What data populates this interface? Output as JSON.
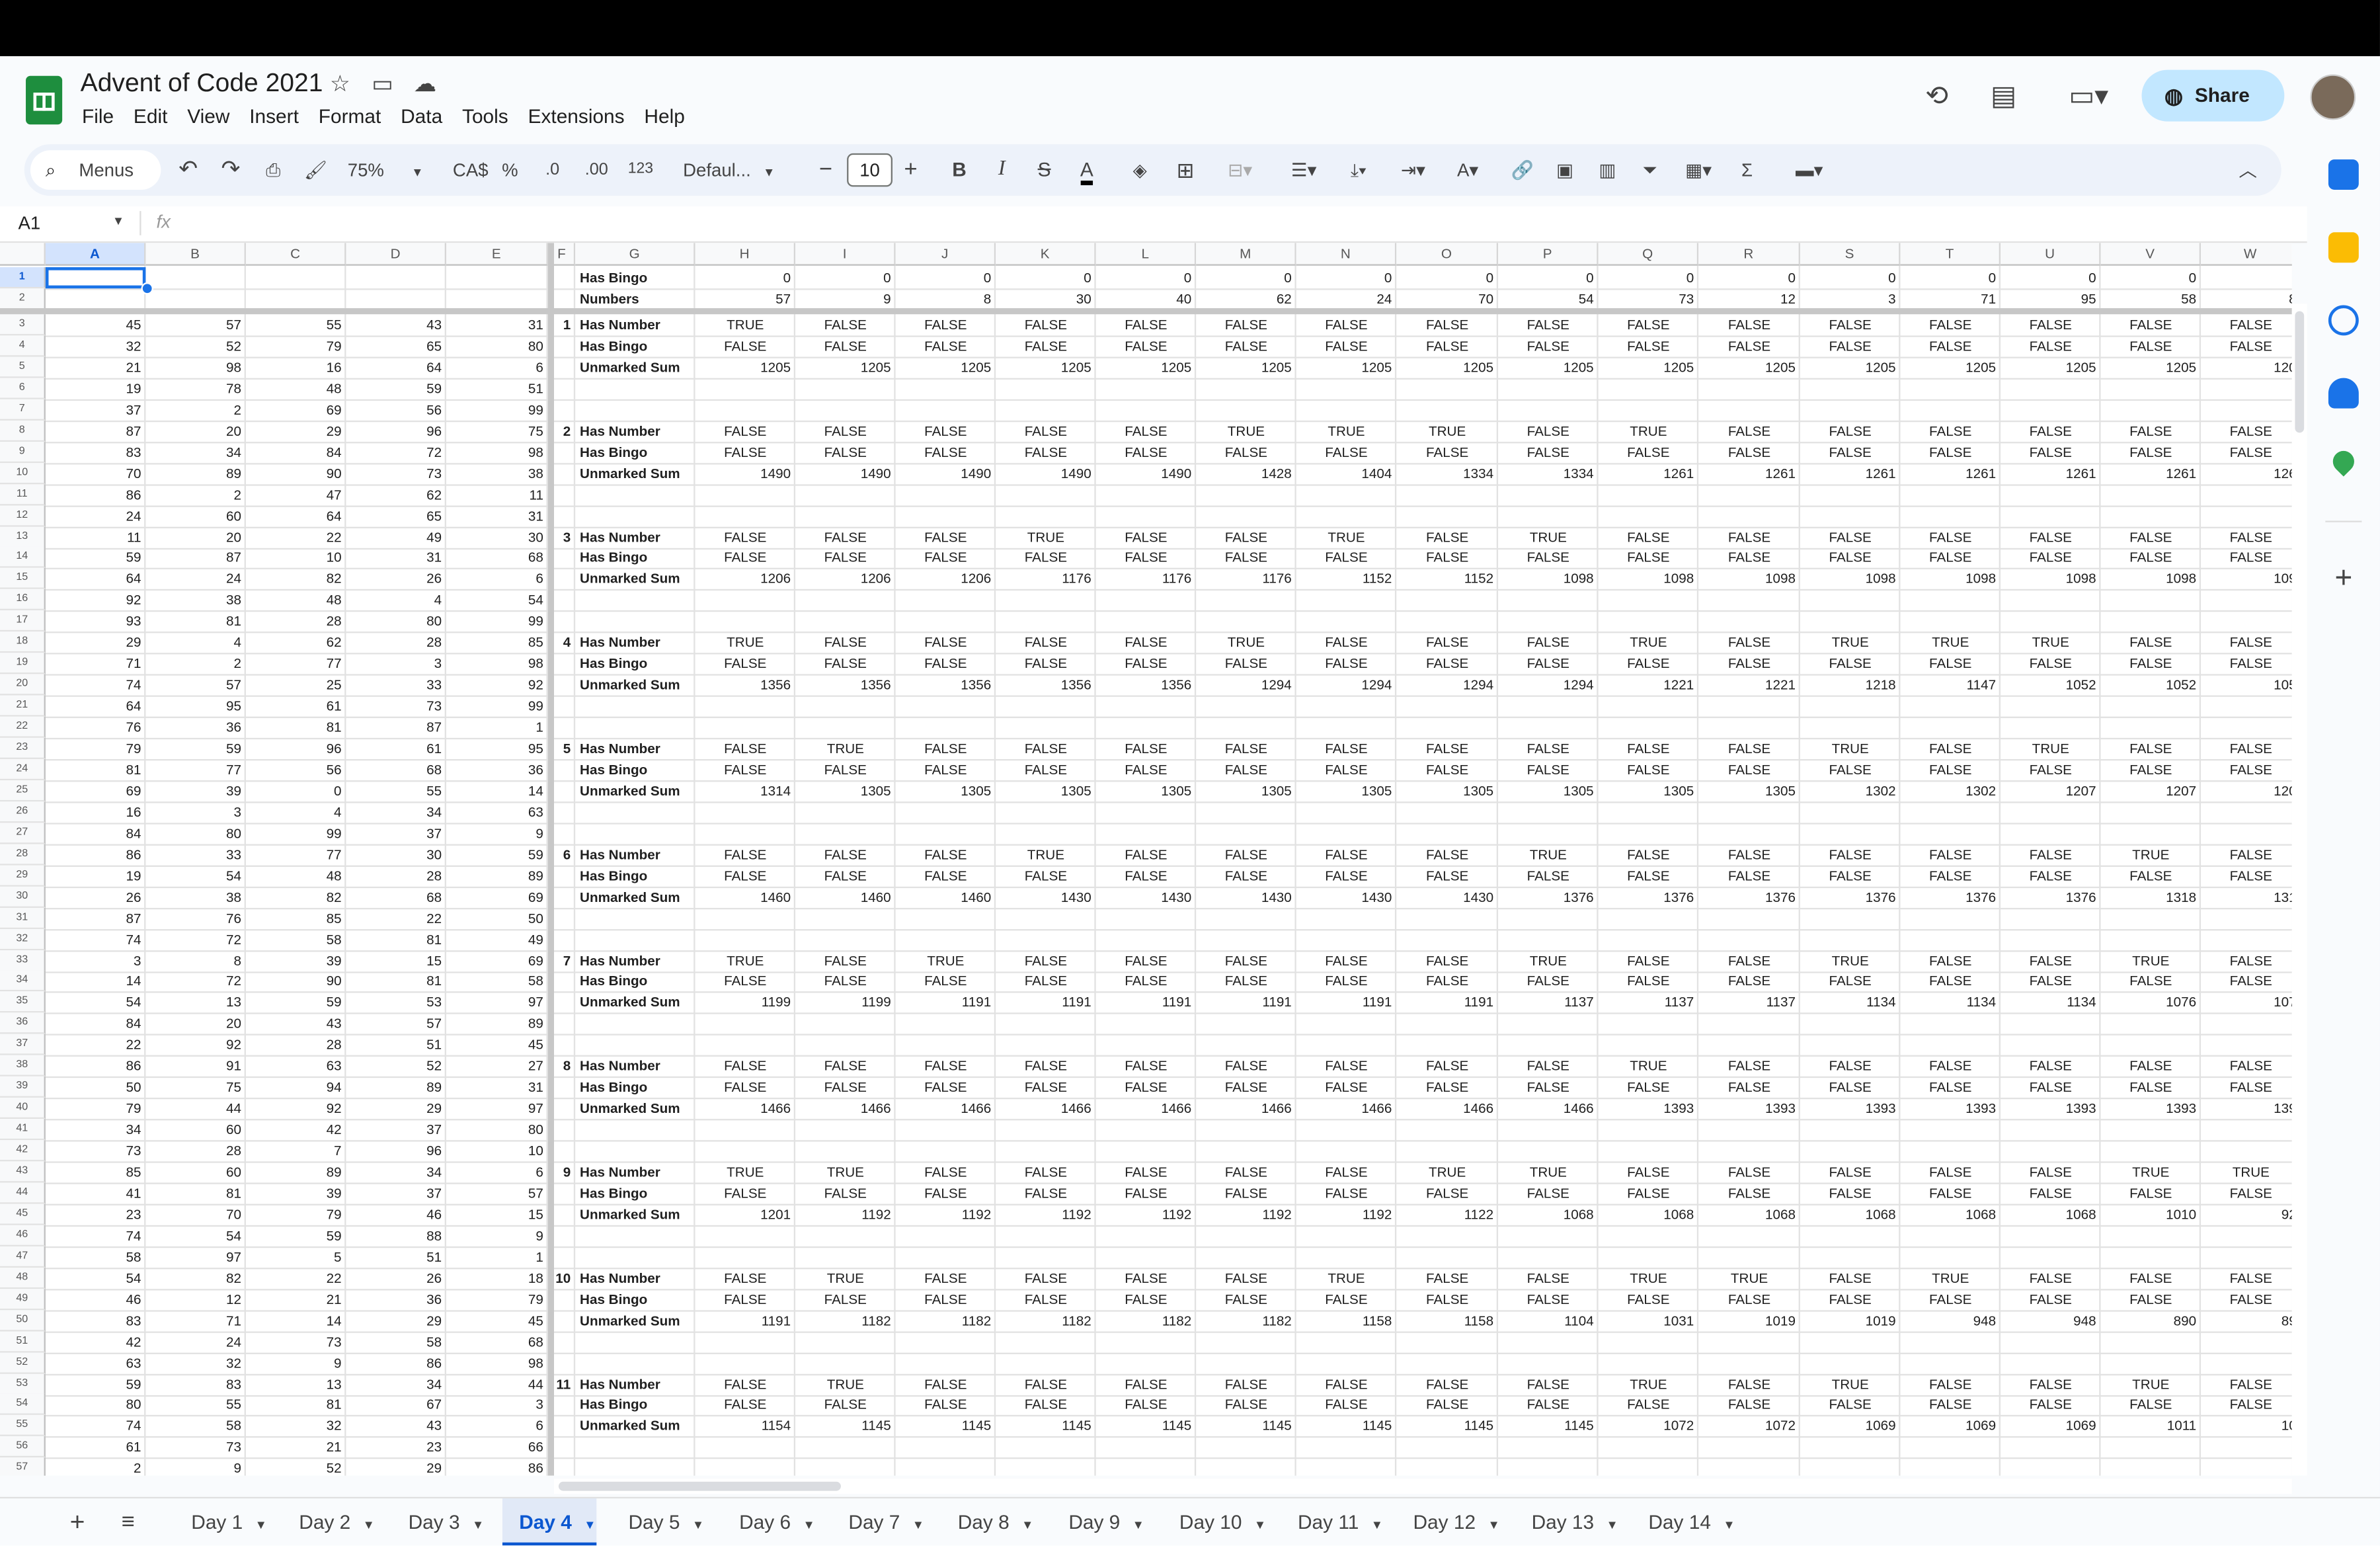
{
  "window": {
    "title": "Advent of Code 2021"
  },
  "menubar": [
    "File",
    "Edit",
    "View",
    "Insert",
    "Format",
    "Data",
    "Tools",
    "Extensions",
    "Help"
  ],
  "header": {
    "share_label": "Share"
  },
  "toolbar": {
    "search_label": "Menus",
    "zoom": "75%",
    "currency": "CA$",
    "percent": "%",
    "decimal_less": ".0",
    "decimal_more": ".00",
    "number_format": "123",
    "font": "Defaul...",
    "font_size": "10"
  },
  "formula_bar": {
    "cell_ref": "A1",
    "fx_label": "fx",
    "value": ""
  },
  "columns": [
    "A",
    "B",
    "C",
    "D",
    "E",
    "F",
    "G",
    "H",
    "I",
    "J",
    "K",
    "L",
    "M",
    "N",
    "O",
    "P",
    "Q",
    "R",
    "S",
    "T",
    "U",
    "V",
    "W"
  ],
  "header_rows": {
    "row1_label": "Has Bingo",
    "row1_values": [
      "0",
      "0",
      "0",
      "0",
      "0",
      "0",
      "0",
      "0",
      "0",
      "0",
      "0",
      "0",
      "0",
      "0",
      "0"
    ],
    "row2_label": "Numbers",
    "row2_values": [
      "57",
      "9",
      "8",
      "30",
      "40",
      "62",
      "24",
      "70",
      "54",
      "73",
      "12",
      "3",
      "71",
      "95",
      "58",
      "8"
    ]
  },
  "labels": {
    "has_number": "Has Number",
    "has_bingo": "Has Bingo",
    "unmarked_sum": "Unmarked Sum"
  },
  "input_rows": [
    [
      "45",
      "57",
      "55",
      "43",
      "31"
    ],
    [
      "32",
      "52",
      "79",
      "65",
      "80"
    ],
    [
      "21",
      "98",
      "16",
      "64",
      "6"
    ],
    [
      "19",
      "78",
      "48",
      "59",
      "51"
    ],
    [
      "37",
      "2",
      "69",
      "56",
      "99"
    ],
    [
      "87",
      "20",
      "29",
      "96",
      "75"
    ],
    [
      "83",
      "34",
      "84",
      "72",
      "98"
    ],
    [
      "70",
      "89",
      "90",
      "73",
      "38"
    ],
    [
      "86",
      "2",
      "47",
      "62",
      "11"
    ],
    [
      "24",
      "60",
      "64",
      "65",
      "31"
    ],
    [
      "11",
      "20",
      "22",
      "49",
      "30"
    ],
    [
      "59",
      "87",
      "10",
      "31",
      "68"
    ],
    [
      "64",
      "24",
      "82",
      "26",
      "6"
    ],
    [
      "92",
      "38",
      "48",
      "4",
      "54"
    ],
    [
      "93",
      "81",
      "28",
      "80",
      "99"
    ],
    [
      "29",
      "4",
      "62",
      "28",
      "85"
    ],
    [
      "71",
      "2",
      "77",
      "3",
      "98"
    ],
    [
      "74",
      "57",
      "25",
      "33",
      "92"
    ],
    [
      "64",
      "95",
      "61",
      "73",
      "99"
    ],
    [
      "76",
      "36",
      "81",
      "87",
      "1"
    ],
    [
      "79",
      "59",
      "96",
      "61",
      "95"
    ],
    [
      "81",
      "77",
      "56",
      "68",
      "36"
    ],
    [
      "69",
      "39",
      "0",
      "55",
      "14"
    ],
    [
      "16",
      "3",
      "4",
      "34",
      "63"
    ],
    [
      "84",
      "80",
      "99",
      "37",
      "9"
    ],
    [
      "86",
      "33",
      "77",
      "30",
      "59"
    ],
    [
      "19",
      "54",
      "48",
      "28",
      "89"
    ],
    [
      "26",
      "38",
      "82",
      "68",
      "69"
    ],
    [
      "87",
      "76",
      "85",
      "22",
      "50"
    ],
    [
      "74",
      "72",
      "58",
      "81",
      "49"
    ],
    [
      "3",
      "8",
      "39",
      "15",
      "69"
    ],
    [
      "14",
      "72",
      "90",
      "81",
      "58"
    ],
    [
      "54",
      "13",
      "59",
      "53",
      "97"
    ],
    [
      "84",
      "20",
      "43",
      "57",
      "89"
    ],
    [
      "22",
      "92",
      "28",
      "51",
      "45"
    ],
    [
      "86",
      "91",
      "63",
      "52",
      "27"
    ],
    [
      "50",
      "75",
      "94",
      "89",
      "31"
    ],
    [
      "79",
      "44",
      "92",
      "29",
      "97"
    ],
    [
      "34",
      "60",
      "42",
      "37",
      "80"
    ],
    [
      "73",
      "28",
      "7",
      "96",
      "10"
    ],
    [
      "85",
      "60",
      "89",
      "34",
      "6"
    ],
    [
      "41",
      "81",
      "39",
      "37",
      "57"
    ],
    [
      "23",
      "70",
      "79",
      "46",
      "15"
    ],
    [
      "74",
      "54",
      "59",
      "88",
      "9"
    ],
    [
      "58",
      "97",
      "5",
      "51",
      "1"
    ],
    [
      "54",
      "82",
      "22",
      "26",
      "18"
    ],
    [
      "46",
      "12",
      "21",
      "36",
      "79"
    ],
    [
      "83",
      "71",
      "14",
      "29",
      "45"
    ],
    [
      "42",
      "24",
      "73",
      "58",
      "68"
    ],
    [
      "63",
      "32",
      "9",
      "86",
      "98"
    ],
    [
      "59",
      "83",
      "13",
      "34",
      "44"
    ],
    [
      "80",
      "55",
      "81",
      "67",
      "3"
    ],
    [
      "74",
      "58",
      "32",
      "43",
      "6"
    ],
    [
      "61",
      "73",
      "21",
      "23",
      "66"
    ],
    [
      "2",
      "9",
      "52",
      "29",
      "86"
    ]
  ],
  "boards": [
    {
      "n": "1",
      "has_number": [
        "TRUE",
        "FALSE",
        "FALSE",
        "FALSE",
        "FALSE",
        "FALSE",
        "FALSE",
        "FALSE",
        "FALSE",
        "FALSE",
        "FALSE",
        "FALSE",
        "FALSE",
        "FALSE",
        "FALSE",
        "FALSE"
      ],
      "has_bingo": [
        "FALSE",
        "FALSE",
        "FALSE",
        "FALSE",
        "FALSE",
        "FALSE",
        "FALSE",
        "FALSE",
        "FALSE",
        "FALSE",
        "FALSE",
        "FALSE",
        "FALSE",
        "FALSE",
        "FALSE",
        "FALSE"
      ],
      "unmarked_sum": [
        "1205",
        "1205",
        "1205",
        "1205",
        "1205",
        "1205",
        "1205",
        "1205",
        "1205",
        "1205",
        "1205",
        "1205",
        "1205",
        "1205",
        "1205",
        "120"
      ]
    },
    {
      "n": "2",
      "has_number": [
        "FALSE",
        "FALSE",
        "FALSE",
        "FALSE",
        "FALSE",
        "TRUE",
        "TRUE",
        "TRUE",
        "FALSE",
        "TRUE",
        "FALSE",
        "FALSE",
        "FALSE",
        "FALSE",
        "FALSE",
        "FALSE"
      ],
      "has_bingo": [
        "FALSE",
        "FALSE",
        "FALSE",
        "FALSE",
        "FALSE",
        "FALSE",
        "FALSE",
        "FALSE",
        "FALSE",
        "FALSE",
        "FALSE",
        "FALSE",
        "FALSE",
        "FALSE",
        "FALSE",
        "FALSE"
      ],
      "unmarked_sum": [
        "1490",
        "1490",
        "1490",
        "1490",
        "1490",
        "1428",
        "1404",
        "1334",
        "1334",
        "1261",
        "1261",
        "1261",
        "1261",
        "1261",
        "1261",
        "126"
      ]
    },
    {
      "n": "3",
      "has_number": [
        "FALSE",
        "FALSE",
        "FALSE",
        "TRUE",
        "FALSE",
        "FALSE",
        "TRUE",
        "FALSE",
        "TRUE",
        "FALSE",
        "FALSE",
        "FALSE",
        "FALSE",
        "FALSE",
        "FALSE",
        "FALSE"
      ],
      "has_bingo": [
        "FALSE",
        "FALSE",
        "FALSE",
        "FALSE",
        "FALSE",
        "FALSE",
        "FALSE",
        "FALSE",
        "FALSE",
        "FALSE",
        "FALSE",
        "FALSE",
        "FALSE",
        "FALSE",
        "FALSE",
        "FALSE"
      ],
      "unmarked_sum": [
        "1206",
        "1206",
        "1206",
        "1176",
        "1176",
        "1176",
        "1152",
        "1152",
        "1098",
        "1098",
        "1098",
        "1098",
        "1098",
        "1098",
        "1098",
        "109"
      ]
    },
    {
      "n": "4",
      "has_number": [
        "TRUE",
        "FALSE",
        "FALSE",
        "FALSE",
        "FALSE",
        "TRUE",
        "FALSE",
        "FALSE",
        "FALSE",
        "TRUE",
        "FALSE",
        "TRUE",
        "TRUE",
        "TRUE",
        "FALSE",
        "FALSE"
      ],
      "has_bingo": [
        "FALSE",
        "FALSE",
        "FALSE",
        "FALSE",
        "FALSE",
        "FALSE",
        "FALSE",
        "FALSE",
        "FALSE",
        "FALSE",
        "FALSE",
        "FALSE",
        "FALSE",
        "FALSE",
        "FALSE",
        "FALSE"
      ],
      "unmarked_sum": [
        "1356",
        "1356",
        "1356",
        "1356",
        "1356",
        "1294",
        "1294",
        "1294",
        "1294",
        "1221",
        "1221",
        "1218",
        "1147",
        "1052",
        "1052",
        "105"
      ]
    },
    {
      "n": "5",
      "has_number": [
        "FALSE",
        "TRUE",
        "FALSE",
        "FALSE",
        "FALSE",
        "FALSE",
        "FALSE",
        "FALSE",
        "FALSE",
        "FALSE",
        "FALSE",
        "TRUE",
        "FALSE",
        "TRUE",
        "FALSE",
        "FALSE"
      ],
      "has_bingo": [
        "FALSE",
        "FALSE",
        "FALSE",
        "FALSE",
        "FALSE",
        "FALSE",
        "FALSE",
        "FALSE",
        "FALSE",
        "FALSE",
        "FALSE",
        "FALSE",
        "FALSE",
        "FALSE",
        "FALSE",
        "FALSE"
      ],
      "unmarked_sum": [
        "1314",
        "1305",
        "1305",
        "1305",
        "1305",
        "1305",
        "1305",
        "1305",
        "1305",
        "1305",
        "1305",
        "1302",
        "1302",
        "1207",
        "1207",
        "120"
      ]
    },
    {
      "n": "6",
      "has_number": [
        "FALSE",
        "FALSE",
        "FALSE",
        "TRUE",
        "FALSE",
        "FALSE",
        "FALSE",
        "FALSE",
        "TRUE",
        "FALSE",
        "FALSE",
        "FALSE",
        "FALSE",
        "FALSE",
        "TRUE",
        "FALSE"
      ],
      "has_bingo": [
        "FALSE",
        "FALSE",
        "FALSE",
        "FALSE",
        "FALSE",
        "FALSE",
        "FALSE",
        "FALSE",
        "FALSE",
        "FALSE",
        "FALSE",
        "FALSE",
        "FALSE",
        "FALSE",
        "FALSE",
        "FALSE"
      ],
      "unmarked_sum": [
        "1460",
        "1460",
        "1460",
        "1430",
        "1430",
        "1430",
        "1430",
        "1430",
        "1376",
        "1376",
        "1376",
        "1376",
        "1376",
        "1376",
        "1318",
        "131"
      ]
    },
    {
      "n": "7",
      "has_number": [
        "TRUE",
        "FALSE",
        "TRUE",
        "FALSE",
        "FALSE",
        "FALSE",
        "FALSE",
        "FALSE",
        "TRUE",
        "FALSE",
        "FALSE",
        "TRUE",
        "FALSE",
        "FALSE",
        "TRUE",
        "FALSE"
      ],
      "has_bingo": [
        "FALSE",
        "FALSE",
        "FALSE",
        "FALSE",
        "FALSE",
        "FALSE",
        "FALSE",
        "FALSE",
        "FALSE",
        "FALSE",
        "FALSE",
        "FALSE",
        "FALSE",
        "FALSE",
        "FALSE",
        "FALSE"
      ],
      "unmarked_sum": [
        "1199",
        "1199",
        "1191",
        "1191",
        "1191",
        "1191",
        "1191",
        "1191",
        "1137",
        "1137",
        "1137",
        "1134",
        "1134",
        "1134",
        "1076",
        "107"
      ]
    },
    {
      "n": "8",
      "has_number": [
        "FALSE",
        "FALSE",
        "FALSE",
        "FALSE",
        "FALSE",
        "FALSE",
        "FALSE",
        "FALSE",
        "FALSE",
        "TRUE",
        "FALSE",
        "FALSE",
        "FALSE",
        "FALSE",
        "FALSE",
        "FALSE"
      ],
      "has_bingo": [
        "FALSE",
        "FALSE",
        "FALSE",
        "FALSE",
        "FALSE",
        "FALSE",
        "FALSE",
        "FALSE",
        "FALSE",
        "FALSE",
        "FALSE",
        "FALSE",
        "FALSE",
        "FALSE",
        "FALSE",
        "FALSE"
      ],
      "unmarked_sum": [
        "1466",
        "1466",
        "1466",
        "1466",
        "1466",
        "1466",
        "1466",
        "1466",
        "1466",
        "1393",
        "1393",
        "1393",
        "1393",
        "1393",
        "1393",
        "139"
      ]
    },
    {
      "n": "9",
      "has_number": [
        "TRUE",
        "TRUE",
        "FALSE",
        "FALSE",
        "FALSE",
        "FALSE",
        "FALSE",
        "TRUE",
        "TRUE",
        "FALSE",
        "FALSE",
        "FALSE",
        "FALSE",
        "FALSE",
        "TRUE",
        "TRUE"
      ],
      "has_bingo": [
        "FALSE",
        "FALSE",
        "FALSE",
        "FALSE",
        "FALSE",
        "FALSE",
        "FALSE",
        "FALSE",
        "FALSE",
        "FALSE",
        "FALSE",
        "FALSE",
        "FALSE",
        "FALSE",
        "FALSE",
        "FALSE"
      ],
      "unmarked_sum": [
        "1201",
        "1192",
        "1192",
        "1192",
        "1192",
        "1192",
        "1192",
        "1122",
        "1068",
        "1068",
        "1068",
        "1068",
        "1068",
        "1068",
        "1010",
        "92"
      ]
    },
    {
      "n": "10",
      "has_number": [
        "FALSE",
        "TRUE",
        "FALSE",
        "FALSE",
        "FALSE",
        "FALSE",
        "TRUE",
        "FALSE",
        "FALSE",
        "TRUE",
        "TRUE",
        "FALSE",
        "TRUE",
        "FALSE",
        "FALSE",
        "FALSE"
      ],
      "has_bingo": [
        "FALSE",
        "FALSE",
        "FALSE",
        "FALSE",
        "FALSE",
        "FALSE",
        "FALSE",
        "FALSE",
        "FALSE",
        "FALSE",
        "FALSE",
        "FALSE",
        "FALSE",
        "FALSE",
        "FALSE",
        "FALSE"
      ],
      "unmarked_sum": [
        "1191",
        "1182",
        "1182",
        "1182",
        "1182",
        "1182",
        "1158",
        "1158",
        "1104",
        "1031",
        "1019",
        "1019",
        "948",
        "948",
        "890",
        "89"
      ]
    },
    {
      "n": "11",
      "has_number": [
        "FALSE",
        "TRUE",
        "FALSE",
        "FALSE",
        "FALSE",
        "FALSE",
        "FALSE",
        "FALSE",
        "FALSE",
        "TRUE",
        "FALSE",
        "TRUE",
        "FALSE",
        "FALSE",
        "TRUE",
        "FALSE"
      ],
      "has_bingo": [
        "FALSE",
        "FALSE",
        "FALSE",
        "FALSE",
        "FALSE",
        "FALSE",
        "FALSE",
        "FALSE",
        "FALSE",
        "FALSE",
        "FALSE",
        "FALSE",
        "FALSE",
        "FALSE",
        "FALSE",
        "FALSE"
      ],
      "unmarked_sum": [
        "1154",
        "1145",
        "1145",
        "1145",
        "1145",
        "1145",
        "1145",
        "1145",
        "1145",
        "1072",
        "1072",
        "1069",
        "1069",
        "1069",
        "1011",
        "10"
      ]
    }
  ],
  "sheet_tabs": [
    "Day 1",
    "Day 2",
    "Day 3",
    "Day 4",
    "Day 5",
    "Day 6",
    "Day 7",
    "Day 8",
    "Day 9",
    "Day 10",
    "Day 11",
    "Day 12",
    "Day 13",
    "Day 14"
  ],
  "active_tab": "Day 4",
  "colors": {
    "accent": "#0b57d0",
    "share_bg": "#c2e7ff",
    "sheets_green": "#1e8e3e",
    "selection": "#1a73e8"
  }
}
